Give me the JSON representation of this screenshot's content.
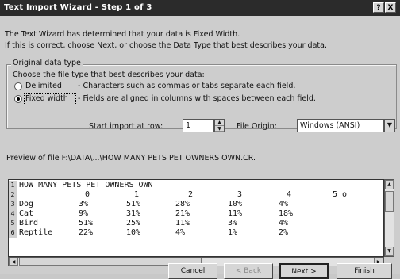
{
  "window": {
    "title": "Text Import Wizard - Step 1 of 3",
    "help_btn": "?",
    "close_btn": "X"
  },
  "intro": {
    "line1": "The Text Wizard has determined that your data is Fixed Width.",
    "line2": "If this is correct, choose Next, or choose the Data Type that best describes your data."
  },
  "data_type": {
    "group_label": "Original data type",
    "prompt": "Choose the file type that best describes your data:",
    "options": [
      {
        "label": "Delimited",
        "desc": "- Characters such as commas or tabs separate each field.",
        "selected": false
      },
      {
        "label": "Fixed width",
        "desc": "- Fields are aligned in columns with spaces between each field.",
        "selected": true
      }
    ]
  },
  "start_row": {
    "label": "Start import at row:",
    "value": "1"
  },
  "origin": {
    "label": "File Origin:",
    "value": "Windows (ANSI)"
  },
  "preview": {
    "caption": "Preview of file F:\\DATA\\...\\HOW MANY PETS PET OWNERS OWN.CR.",
    "rows": [
      {
        "num": "1",
        "cells": [
          "HOW MANY PETS PET OWNERS OWN"
        ]
      },
      {
        "num": "2",
        "cells": [
          "",
          "0",
          "1",
          "2",
          "3",
          "4",
          "5 o"
        ]
      },
      {
        "num": "3",
        "cells": [
          "Dog",
          "3%",
          "51%",
          "28%",
          "10%",
          "4%",
          ""
        ]
      },
      {
        "num": "4",
        "cells": [
          "Cat",
          "9%",
          "31%",
          "21%",
          "11%",
          "18%",
          ""
        ]
      },
      {
        "num": "5",
        "cells": [
          "Bird",
          "51%",
          "25%",
          "11%",
          "3%",
          "4%",
          ""
        ]
      },
      {
        "num": "6",
        "cells": [
          "Reptile",
          "22%",
          "10%",
          "4%",
          "1%",
          "2%",
          ""
        ]
      }
    ]
  },
  "buttons": {
    "cancel": "Cancel",
    "back": "< Back",
    "next": "Next >",
    "finish": "Finish"
  },
  "icons": {
    "scroll_up": "▲",
    "scroll_down": "▼",
    "scroll_left": "◀",
    "scroll_right": "▶",
    "dropdown": "▼"
  }
}
